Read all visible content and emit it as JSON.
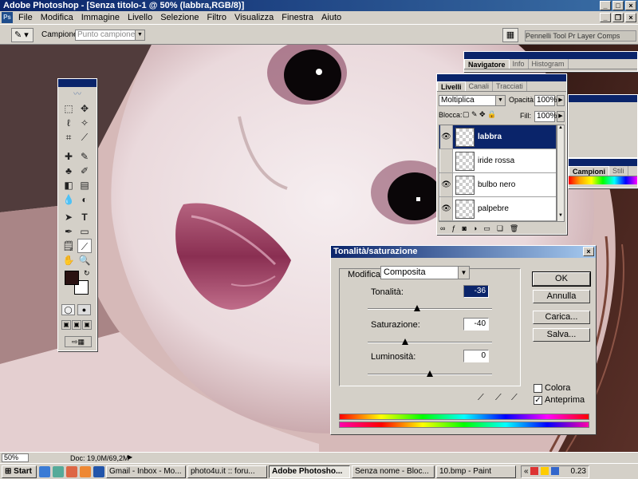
{
  "window": {
    "title": "Adobe Photoshop - [Senza titolo-1 @ 50% (labbra,RGB/8)]"
  },
  "menu": [
    "File",
    "Modifica",
    "Immagine",
    "Livello",
    "Selezione",
    "Filtro",
    "Visualizza",
    "Finestra",
    "Aiuto"
  ],
  "options": {
    "sample_label": "Campione:",
    "sample_value": "Punto campione",
    "well_tabs": "Pennelli  Tool Pr  Layer Comps"
  },
  "navigator": {
    "tabs": [
      "Navigatore",
      "Info",
      "Histogram"
    ]
  },
  "swatches": {
    "tabs": [
      "Campioni",
      "Stili"
    ]
  },
  "layers": {
    "tabs": [
      "Livelli",
      "Canali",
      "Tracciati"
    ],
    "blend_mode": "Moltiplica",
    "opacity_label": "Opacità:",
    "opacity_value": "100%",
    "lock_label": "Blocca:",
    "fill_label": "Fill:",
    "fill_value": "100%",
    "items": [
      {
        "name": "labbra",
        "visible": true,
        "selected": true
      },
      {
        "name": "iride rossa",
        "visible": false,
        "selected": false
      },
      {
        "name": "bulbo nero",
        "visible": true,
        "selected": false
      },
      {
        "name": "palpebre",
        "visible": true,
        "selected": false
      }
    ]
  },
  "dialog": {
    "title": "Tonalità/saturazione",
    "edit_label": "Modifica:",
    "edit_value": "Composita",
    "hue_label": "Tonalità:",
    "hue_value": "-36",
    "sat_label": "Saturazione:",
    "sat_value": "-40",
    "light_label": "Luminosità:",
    "light_value": "0",
    "ok": "OK",
    "cancel": "Annulla",
    "load": "Carica...",
    "save": "Salva...",
    "colorize_label": "Colora",
    "preview_label": "Anteprima",
    "colorize": false,
    "preview": true
  },
  "status": {
    "zoom": "50%",
    "doc": "Doc: 19,0M/69,2M"
  },
  "taskbar": {
    "start": "Start",
    "items": [
      "Gmail - Inbox - Mo...",
      "photo4u.it :: foru...",
      "Adobe Photosho...",
      "Senza nome - Bloc...",
      "10.bmp - Paint"
    ],
    "active_index": 2,
    "clock": "0.23"
  },
  "colors": {
    "titlebar": "#0a246a",
    "foreground": "#2a1212",
    "background": "#ffffff"
  }
}
